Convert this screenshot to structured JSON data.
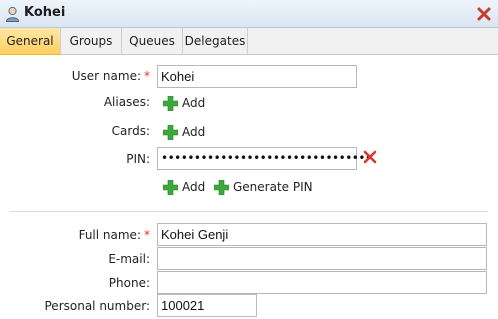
{
  "window": {
    "title": "Kohei",
    "icon": "user-icon",
    "close_icon": "close-icon"
  },
  "tabs": [
    {
      "label": "General",
      "active": true
    },
    {
      "label": "Groups",
      "active": false
    },
    {
      "label": "Queues",
      "active": false
    },
    {
      "label": "Delegates",
      "active": false
    }
  ],
  "form": {
    "username": {
      "label": "User name:",
      "value": "Kohei",
      "required_mark": "*"
    },
    "aliases": {
      "label": "Aliases:",
      "add_label": "Add"
    },
    "cards": {
      "label": "Cards:",
      "add_label": "Add"
    },
    "pin": {
      "label": "PIN:",
      "value": "••••••••••••••••••••••••••••••••",
      "add_label": "Add",
      "generate_label": "Generate PIN"
    },
    "fullname": {
      "label": "Full name:",
      "value": "Kohei Genji",
      "required_mark": "*"
    },
    "email": {
      "label": "E-mail:",
      "value": ""
    },
    "phone": {
      "label": "Phone:",
      "value": ""
    },
    "personal_number": {
      "label": "Personal number:",
      "value": "100021"
    }
  },
  "colors": {
    "accent_tab": "#ffcf5f",
    "add_green": "#3aa83a",
    "delete_red": "#d8382d"
  }
}
